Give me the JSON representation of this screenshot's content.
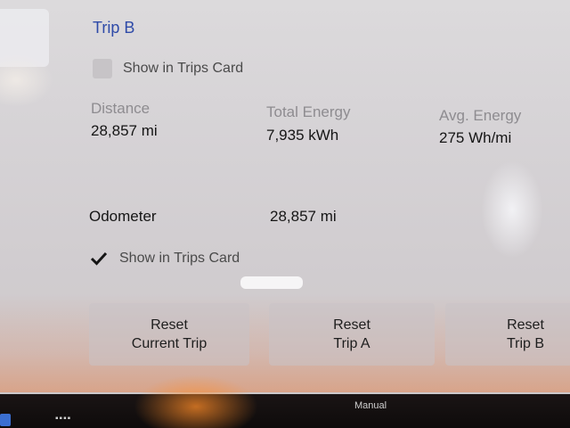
{
  "trip": {
    "title": "Trip B",
    "show_in_trips_card_label": "Show in Trips Card",
    "show_in_trips_card_checked": false
  },
  "stats": [
    {
      "label": "Distance",
      "value": "28,857 mi"
    },
    {
      "label": "Total Energy",
      "value": "7,935 kWh"
    },
    {
      "label": "Avg. Energy",
      "value": "275 Wh/mi"
    }
  ],
  "odometer": {
    "label": "Odometer",
    "value": "28,857 mi",
    "show_in_trips_card_label": "Show in Trips Card",
    "show_in_trips_card_checked": true
  },
  "buttons": {
    "reset_current_line1": "Reset",
    "reset_current_line2": "Current Trip",
    "reset_a_line1": "Reset",
    "reset_a_line2": "Trip A",
    "reset_b_line1": "Reset",
    "reset_b_line2": "Trip B"
  },
  "bottom_bar": {
    "manual_label": "Manual"
  },
  "colors": {
    "accent": "#2e4aa8",
    "background": "#d6d3d6"
  }
}
